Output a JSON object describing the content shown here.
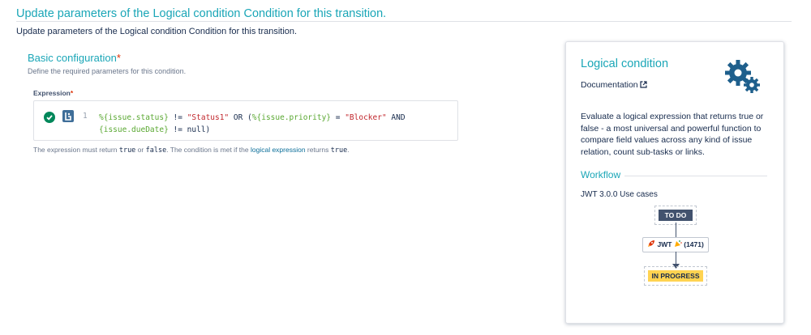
{
  "page": {
    "header_title": "Update parameters of the Logical condition Condition for this transition.",
    "subtitle": "Update parameters of the Logical condition Condition for this transition."
  },
  "basic": {
    "title": "Basic configuration",
    "required_marker": "*",
    "description": "Define the required parameters for this condition."
  },
  "expression": {
    "label": "Expression",
    "required_marker": "*",
    "line_number": "1",
    "code": {
      "p1": "%{issue.status}",
      "p2": " != ",
      "p3": "\"Status1\"",
      "p4": " OR (",
      "p5": "%{issue.priority}",
      "p6": " = ",
      "p7": "\"Blocker\"",
      "p8": " AND",
      "p9": "{issue.dueDate}",
      "p10": " != null)"
    },
    "help": {
      "a": "The expression must return ",
      "b": "true",
      "c": " or ",
      "d": "false",
      "e": ". The condition is met if the ",
      "link": "logical expression",
      "f": " returns ",
      "g": "true",
      "h": "."
    }
  },
  "panel": {
    "title": "Logical condition",
    "documentation": "Documentation",
    "description": "Evaluate a logical expression that returns true or false - a most universal and powerful function to compare field values across any kind of issue relation, count sub-tasks or links.",
    "workflow_title": "Workflow",
    "use_cases": "JWT 3.0.0 Use cases",
    "status_from": "TO DO",
    "transition": "JWT",
    "transition_count": "(1471)",
    "status_to": "IN PROGRESS"
  },
  "colors": {
    "accent": "#1aa6b7",
    "required": "#de350b",
    "valid": "#00875a",
    "status_todo": "#42526e",
    "status_inprogress": "#ffd351"
  },
  "icons": [
    "check-valid-icon",
    "expression-helper-icon",
    "external-link-icon",
    "gears-icon",
    "rocket-icon",
    "party-icon"
  ]
}
